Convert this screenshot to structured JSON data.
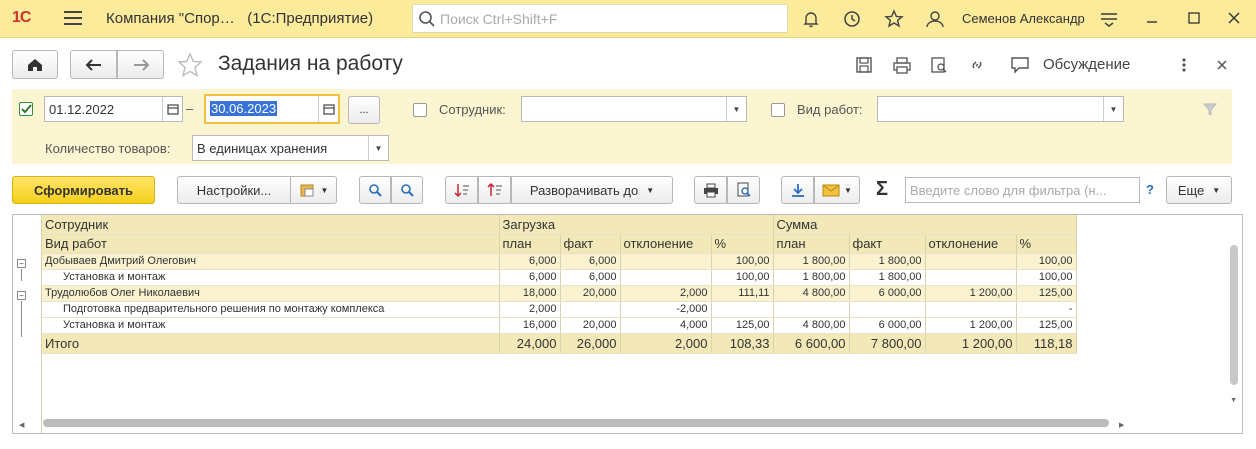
{
  "app": {
    "logo": "1С",
    "title": "Компания \"Спор…",
    "platform": "(1С:Предприятие)",
    "search_placeholder": "Поиск Ctrl+Shift+F",
    "user": "Семенов Александр"
  },
  "form": {
    "title": "Задания на работу",
    "discussion": "Обсуждение"
  },
  "filters": {
    "date_from": "01.12.2022",
    "dash": "–",
    "date_to": "30.06.2023",
    "dots": "...",
    "employee_label": "Сотрудник:",
    "employee_value": "",
    "worktype_label": "Вид работ:",
    "worktype_value": "",
    "qty_label": "Количество товаров:",
    "qty_value": "В единицах хранения"
  },
  "toolbar": {
    "generate": "Сформировать",
    "settings": "Настройки...",
    "expand": "Разворачивать до",
    "filter_placeholder": "Введите слово для фильтра (н...",
    "help": "?",
    "more": "Еще"
  },
  "report": {
    "h1": [
      "Сотрудник",
      "Загрузка",
      "Сумма"
    ],
    "h2": [
      "Вид работ",
      "план",
      "факт",
      "отклонение",
      "%",
      "план",
      "факт",
      "отклонение",
      "%"
    ],
    "rows": [
      {
        "name": "Добываев Дмитрий Олегович",
        "indent": 0,
        "group": true,
        "vals": [
          "6,000",
          "6,000",
          "",
          "100,00",
          "1 800,00",
          "1 800,00",
          "",
          "100,00"
        ]
      },
      {
        "name": "Установка и монтаж",
        "indent": 1,
        "group": false,
        "vals": [
          "6,000",
          "6,000",
          "",
          "100,00",
          "1 800,00",
          "1 800,00",
          "",
          "100,00"
        ]
      },
      {
        "name": "Трудолюбов Олег Николаевич",
        "indent": 0,
        "group": true,
        "vals": [
          "18,000",
          "20,000",
          "2,000",
          "111,11",
          "4 800,00",
          "6 000,00",
          "1 200,00",
          "125,00"
        ]
      },
      {
        "name": "Подготовка предварительного решения по монтажу комплекса",
        "indent": 1,
        "group": false,
        "vals": [
          "2,000",
          "",
          "-2,000",
          "",
          "",
          "",
          "",
          "-"
        ]
      },
      {
        "name": "Установка и монтаж",
        "indent": 1,
        "group": false,
        "vals": [
          "16,000",
          "20,000",
          "4,000",
          "125,00",
          "4 800,00",
          "6 000,00",
          "1 200,00",
          "125,00"
        ]
      }
    ],
    "total": {
      "name": "Итого",
      "vals": [
        "24,000",
        "26,000",
        "2,000",
        "108,33",
        "6 600,00",
        "7 800,00",
        "1 200,00",
        "118,18"
      ]
    }
  }
}
